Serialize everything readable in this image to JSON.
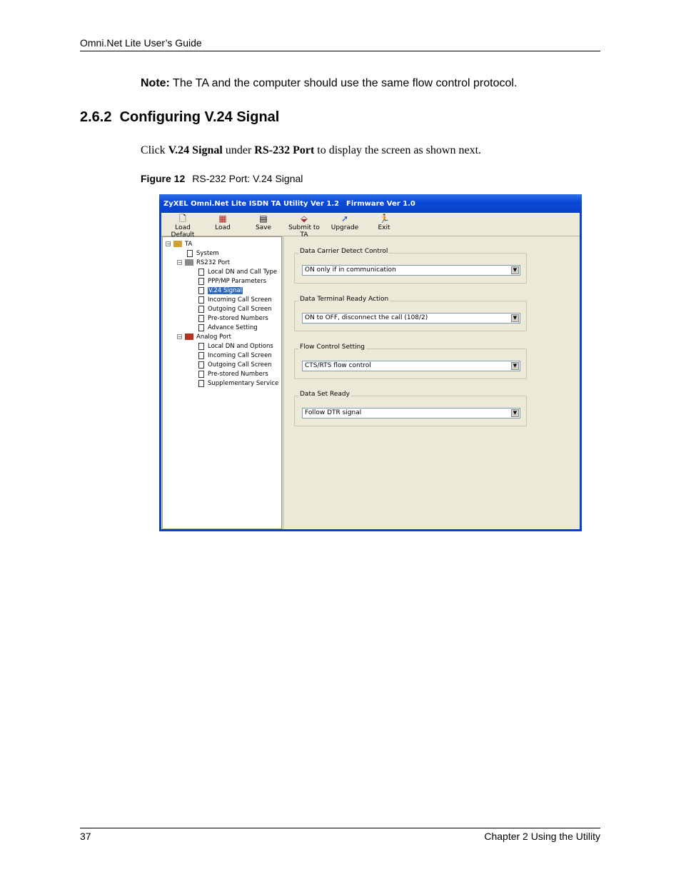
{
  "header": {
    "title": "Omni.Net Lite User’s Guide"
  },
  "note": {
    "label": "Note:",
    "text": " The TA and the computer should use the same flow control protocol."
  },
  "section": {
    "number": "2.6.2",
    "title": "Configuring V.24 Signal"
  },
  "body": {
    "click": "Click ",
    "item": "V.24 Signal",
    "under": " under ",
    "port": "RS-232 Port",
    "rest": " to display the screen as shown next."
  },
  "figure": {
    "label": "Figure 12",
    "caption": "RS-232 Port: V.24 Signal"
  },
  "window": {
    "title": "ZyXEL Omni.Net Lite ISDN TA Utility Ver 1.2",
    "firmware": "Firmware Ver 1.0",
    "toolbar": [
      {
        "label": "Load Default",
        "icon": "new-file-icon"
      },
      {
        "label": "Load",
        "icon": "load-icon"
      },
      {
        "label": "Save",
        "icon": "save-icon"
      },
      {
        "label": "Submit to TA",
        "icon": "submit-icon"
      },
      {
        "label": "Upgrade",
        "icon": "upgrade-icon"
      },
      {
        "label": "Exit",
        "icon": "exit-icon"
      }
    ],
    "tree": {
      "root": "TA",
      "system": "System",
      "rs232": "RS232 Port",
      "rs232_items": [
        "Local DN and Call Type",
        "PPP/MP Parameters",
        "V.24 Signal",
        "Incoming Call Screen",
        "Outgoing Call Screen",
        "Pre-stored Numbers",
        "Advance Setting"
      ],
      "analog": "Analog Port",
      "analog_items": [
        "Local DN and Options",
        "Incoming Call Screen",
        "Outgoing Call Screen",
        "Pre-stored Numbers",
        "Supplementary Service"
      ],
      "selected": "V.24 Signal"
    },
    "groups": [
      {
        "label": "Data Carrier Detect Control",
        "value": "ON only if in communication"
      },
      {
        "label": "Data Terminal Ready Action",
        "value": "ON to OFF, disconnect the call (108/2)"
      },
      {
        "label": "Flow Control Setting",
        "value": "CTS/RTS flow control"
      },
      {
        "label": "Data Set Ready",
        "value": "Follow DTR signal"
      }
    ]
  },
  "footer": {
    "page": "37",
    "chapter": "Chapter 2 Using the Utility"
  }
}
